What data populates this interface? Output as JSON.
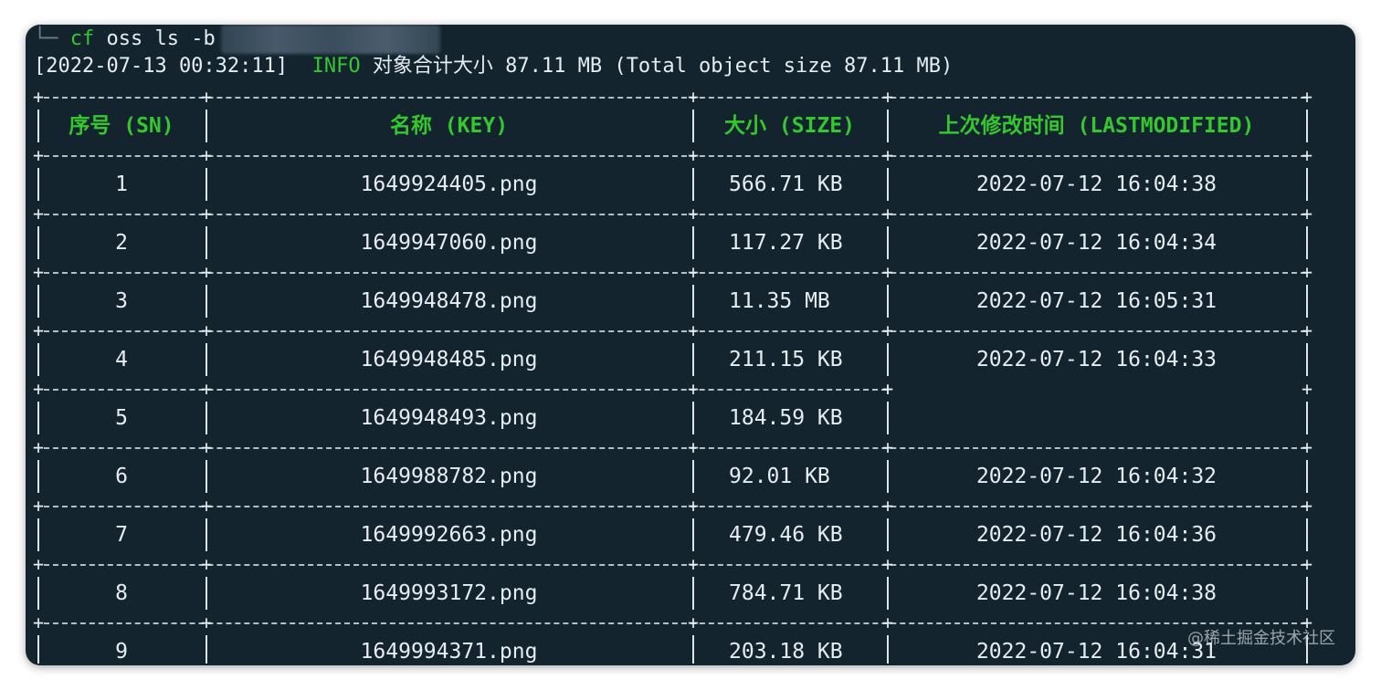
{
  "terminal": {
    "prompt_prefix": "└─",
    "command": "cf",
    "command_args": "oss ls -b",
    "log": {
      "timestamp": "[2022-07-13 00:32:11]",
      "level": "INFO",
      "message": "对象合计大小 87.11 MB (Total object size 87.11 MB)"
    }
  },
  "table": {
    "headers": {
      "sn": "序号 (SN)",
      "key": "名称 (KEY)",
      "size": "大小 (SIZE)",
      "modified": "上次修改时间 (LASTMODIFIED)"
    },
    "rows": [
      {
        "sn": "1",
        "key": "1649924405.png",
        "size": "566.71 KB",
        "modified": "2022-07-12 16:04:38"
      },
      {
        "sn": "2",
        "key": "1649947060.png",
        "size": "117.27 KB",
        "modified": "2022-07-12 16:04:34"
      },
      {
        "sn": "3",
        "key": "1649948478.png",
        "size": "11.35 MB",
        "modified": "2022-07-12 16:05:31"
      },
      {
        "sn": "4",
        "key": "1649948485.png",
        "size": "211.15 KB",
        "modified": "2022-07-12 16:04:33"
      },
      {
        "sn": "5",
        "key": "1649948493.png",
        "size": "184.59 KB",
        "modified": ""
      },
      {
        "sn": "6",
        "key": "1649988782.png",
        "size": "92.01 KB",
        "modified": "2022-07-12 16:04:32"
      },
      {
        "sn": "7",
        "key": "1649992663.png",
        "size": "479.46 KB",
        "modified": "2022-07-12 16:04:36"
      },
      {
        "sn": "8",
        "key": "1649993172.png",
        "size": "784.71 KB",
        "modified": "2022-07-12 16:04:38"
      },
      {
        "sn": "9",
        "key": "1649994371.png",
        "size": "203.18 KB",
        "modified": "2022-07-12 16:04:31"
      }
    ]
  },
  "watermark": "@稀土掘金技术社区"
}
